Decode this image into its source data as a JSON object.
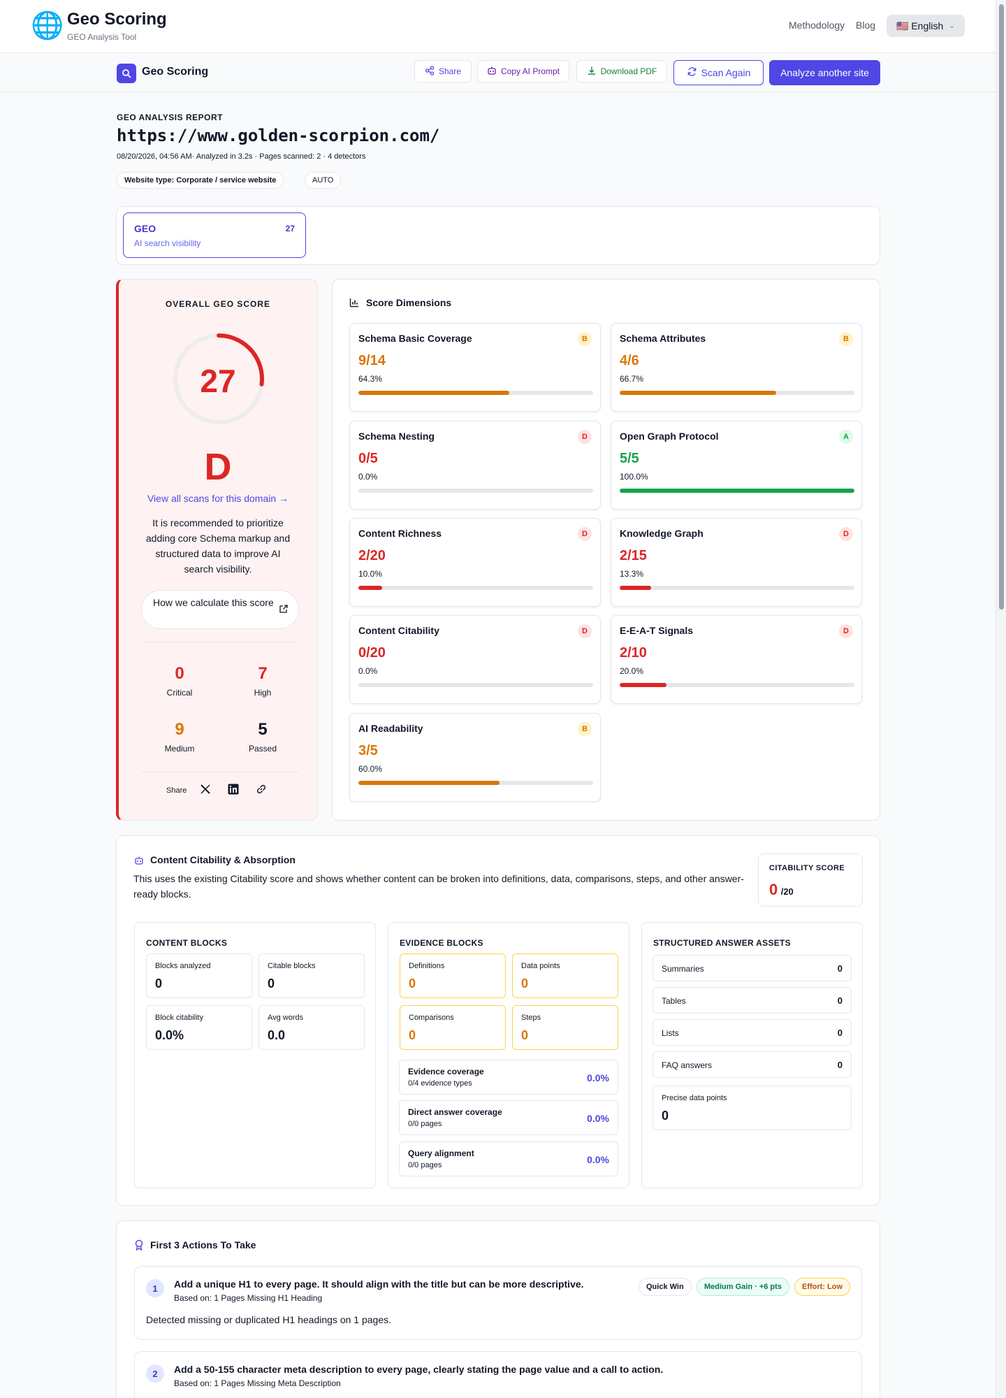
{
  "header": {
    "app_title": "Geo Scoring",
    "app_subtitle": "GEO Analysis Tool",
    "nav_links": [
      "Methodology",
      "Blog"
    ],
    "language": "🇺🇸 English"
  },
  "toolbar": {
    "brand": "Geo Scoring",
    "share": "Share",
    "copy_prompt": "Copy AI Prompt",
    "download_pdf": "Download PDF",
    "scan_again": "Scan Again",
    "analyze_another": "Analyze another site"
  },
  "report": {
    "label": "GEO ANALYSIS REPORT",
    "url": "https://www.golden-scorpion.com/",
    "meta": "08/20/2026, 04:56 AM· Analyzed in 3.2s · Pages scanned: 2 · 4 detectors",
    "website_type": "Website type: Corporate / service website",
    "auto": "AUTO"
  },
  "tab": {
    "title": "GEO",
    "score": "27",
    "subtitle": "AI search visibility"
  },
  "overall": {
    "heading": "OVERALL GEO SCORE",
    "score": "27",
    "score_value": 27,
    "score_max": 100,
    "grade": "D",
    "view_all": "View all scans for this domain →",
    "recommendation": "It is recommended to prioritize adding core Schema markup and structured data to improve AI search visibility.",
    "calc_button": "How we calculate this score",
    "stats": [
      {
        "value": "0",
        "label": "Critical",
        "color": "#dc2626"
      },
      {
        "value": "7",
        "label": "High",
        "color": "#dc2626"
      },
      {
        "value": "9",
        "label": "Medium",
        "color": "#d97706"
      },
      {
        "value": "5",
        "label": "Passed",
        "color": "#111827"
      }
    ],
    "share_label": "Share"
  },
  "dimensions": {
    "heading": "Score Dimensions",
    "items": [
      {
        "name": "Schema Basic Coverage",
        "grade": "B",
        "score": "9/14",
        "percent": "64.3%",
        "fill": 0.643,
        "color": "#d97706",
        "grade_bg": "#fef3c7",
        "grade_color": "#d97706"
      },
      {
        "name": "Schema Attributes",
        "grade": "B",
        "score": "4/6",
        "percent": "66.7%",
        "fill": 0.667,
        "color": "#d97706",
        "grade_bg": "#fef3c7",
        "grade_color": "#d97706"
      },
      {
        "name": "Schema Nesting",
        "grade": "D",
        "score": "0/5",
        "percent": "0.0%",
        "fill": 0,
        "color": "#dc2626",
        "grade_bg": "#fee2e2",
        "grade_color": "#dc2626"
      },
      {
        "name": "Open Graph Protocol",
        "grade": "A",
        "score": "5/5",
        "percent": "100.0%",
        "fill": 1,
        "color": "#16a34a",
        "grade_bg": "#dcfce7",
        "grade_color": "#16a34a"
      },
      {
        "name": "Content Richness",
        "grade": "D",
        "score": "2/20",
        "percent": "10.0%",
        "fill": 0.1,
        "color": "#dc2626",
        "grade_bg": "#fee2e2",
        "grade_color": "#dc2626"
      },
      {
        "name": "Knowledge Graph",
        "grade": "D",
        "score": "2/15",
        "percent": "13.3%",
        "fill": 0.133,
        "color": "#dc2626",
        "grade_bg": "#fee2e2",
        "grade_color": "#dc2626"
      },
      {
        "name": "Content Citability",
        "grade": "D",
        "score": "0/20",
        "percent": "0.0%",
        "fill": 0,
        "color": "#dc2626",
        "grade_bg": "#fee2e2",
        "grade_color": "#dc2626"
      },
      {
        "name": "E-E-A-T Signals",
        "grade": "D",
        "score": "2/10",
        "percent": "20.0%",
        "fill": 0.2,
        "color": "#dc2626",
        "grade_bg": "#fee2e2",
        "grade_color": "#dc2626"
      },
      {
        "name": "AI Readability",
        "grade": "B",
        "score": "3/5",
        "percent": "60.0%",
        "fill": 0.6,
        "color": "#d97706",
        "grade_bg": "#fef3c7",
        "grade_color": "#d97706"
      }
    ]
  },
  "citability": {
    "heading": "Content Citability & Absorption",
    "description": "This uses the existing Citability score and shows whether content can be broken into definitions, data, comparisons, steps, and other answer-ready blocks.",
    "score_label": "CITABILITY SCORE",
    "score": "0",
    "score_max": "/20",
    "content_blocks": {
      "heading": "CONTENT BLOCKS",
      "items": [
        {
          "label": "Blocks analyzed",
          "value": "0"
        },
        {
          "label": "Citable blocks",
          "value": "0"
        },
        {
          "label": "Block citability",
          "value": "0.0%"
        },
        {
          "label": "Avg words",
          "value": "0.0"
        }
      ]
    },
    "evidence_blocks": {
      "heading": "EVIDENCE BLOCKS",
      "items": [
        {
          "label": "Definitions",
          "value": "0"
        },
        {
          "label": "Data points",
          "value": "0"
        },
        {
          "label": "Comparisons",
          "value": "0"
        },
        {
          "label": "Steps",
          "value": "0"
        }
      ],
      "coverage": [
        {
          "label": "Evidence coverage",
          "sub": "0/4 evidence types",
          "value": "0.0%"
        },
        {
          "label": "Direct answer coverage",
          "sub": "0/0 pages",
          "value": "0.0%"
        },
        {
          "label": "Query alignment",
          "sub": "0/0 pages",
          "value": "0.0%"
        }
      ]
    },
    "assets": {
      "heading": "STRUCTURED ANSWER ASSETS",
      "items": [
        {
          "label": "Summaries",
          "value": "0"
        },
        {
          "label": "Tables",
          "value": "0"
        },
        {
          "label": "Lists",
          "value": "0"
        },
        {
          "label": "FAQ answers",
          "value": "0"
        }
      ],
      "precise_label": "Precise data points",
      "precise_value": "0"
    }
  },
  "actions": {
    "heading": "First 3 Actions To Take",
    "items": [
      {
        "num": "1",
        "title": "Add a unique H1 to every page. It should align with the title but can be more descriptive.",
        "based_on": "Based on: 1 Pages Missing H1 Heading",
        "detail": "Detected missing or duplicated H1 headings on 1 pages.",
        "badges": [
          "Quick Win",
          "Medium Gain · +6 pts",
          "Effort: Low"
        ]
      },
      {
        "num": "2",
        "title": "Add a 50-155 character meta description to every page, clearly stating the page value and a call to action.",
        "based_on": "Based on: 1 Pages Missing Meta Description"
      }
    ]
  }
}
